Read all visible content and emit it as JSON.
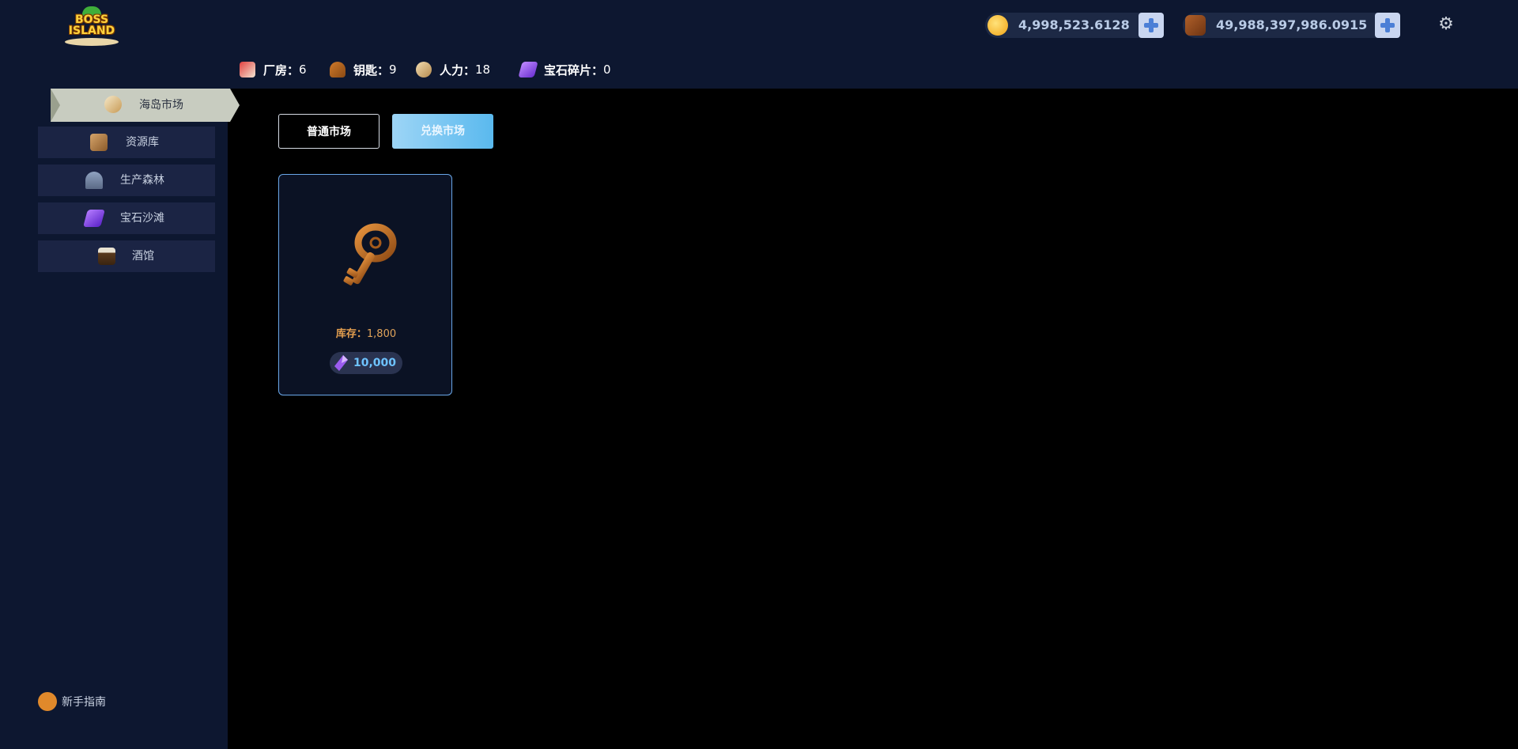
{
  "app": {
    "logo_text_1": "BOSS",
    "logo_text_2": "ISLAND"
  },
  "header": {
    "gold": "4,998,523.6128",
    "wood": "49,988,397,986.0915",
    "icons": {
      "gold": "gold-coin-icon",
      "wood": "wood-logs-icon",
      "add": "plus-icon",
      "settings": "gear-icon"
    }
  },
  "stats": {
    "factory": {
      "label": "厂房：",
      "value": "6",
      "icon": "factory-icon"
    },
    "keys": {
      "label": "钥匙：",
      "value": "9",
      "icon": "key-icon"
    },
    "workers": {
      "label": "人力：",
      "value": "18",
      "icon": "workers-icon"
    },
    "gem_shards": {
      "label": "宝石碎片：",
      "value": "0",
      "icon": "gem-shard-icon"
    }
  },
  "sidebar": {
    "items": [
      {
        "label": "海岛市场",
        "icon": "boat-icon",
        "active": true
      },
      {
        "label": "资源库",
        "icon": "treasure-chest-icon",
        "active": false
      },
      {
        "label": "生产森林",
        "icon": "palm-tree-icon",
        "active": false
      },
      {
        "label": "宝石沙滩",
        "icon": "gem-icon",
        "active": false
      },
      {
        "label": "酒馆",
        "icon": "beer-mug-icon",
        "active": false
      }
    ],
    "guide": {
      "label": "新手指南",
      "icon": "pretzel-icon"
    }
  },
  "main": {
    "tabs": [
      {
        "label": "普通市场",
        "active": false
      },
      {
        "label": "兑换市场",
        "active": true
      }
    ],
    "items": [
      {
        "icon": "key-icon",
        "stock_label": "库存：",
        "stock_value": "1,800",
        "price": "10,000",
        "price_icon": "gem-shard-icon"
      }
    ]
  },
  "colors": {
    "header_bg": "#0d1730",
    "nav_item_bg": "#1b2444",
    "nav_active_bg": "#c8ccc0",
    "tab_active": "#5ab9ee",
    "card_border": "#6aa7e8",
    "price_text": "#6ec3ff",
    "stock_text": "#e0a35a"
  }
}
